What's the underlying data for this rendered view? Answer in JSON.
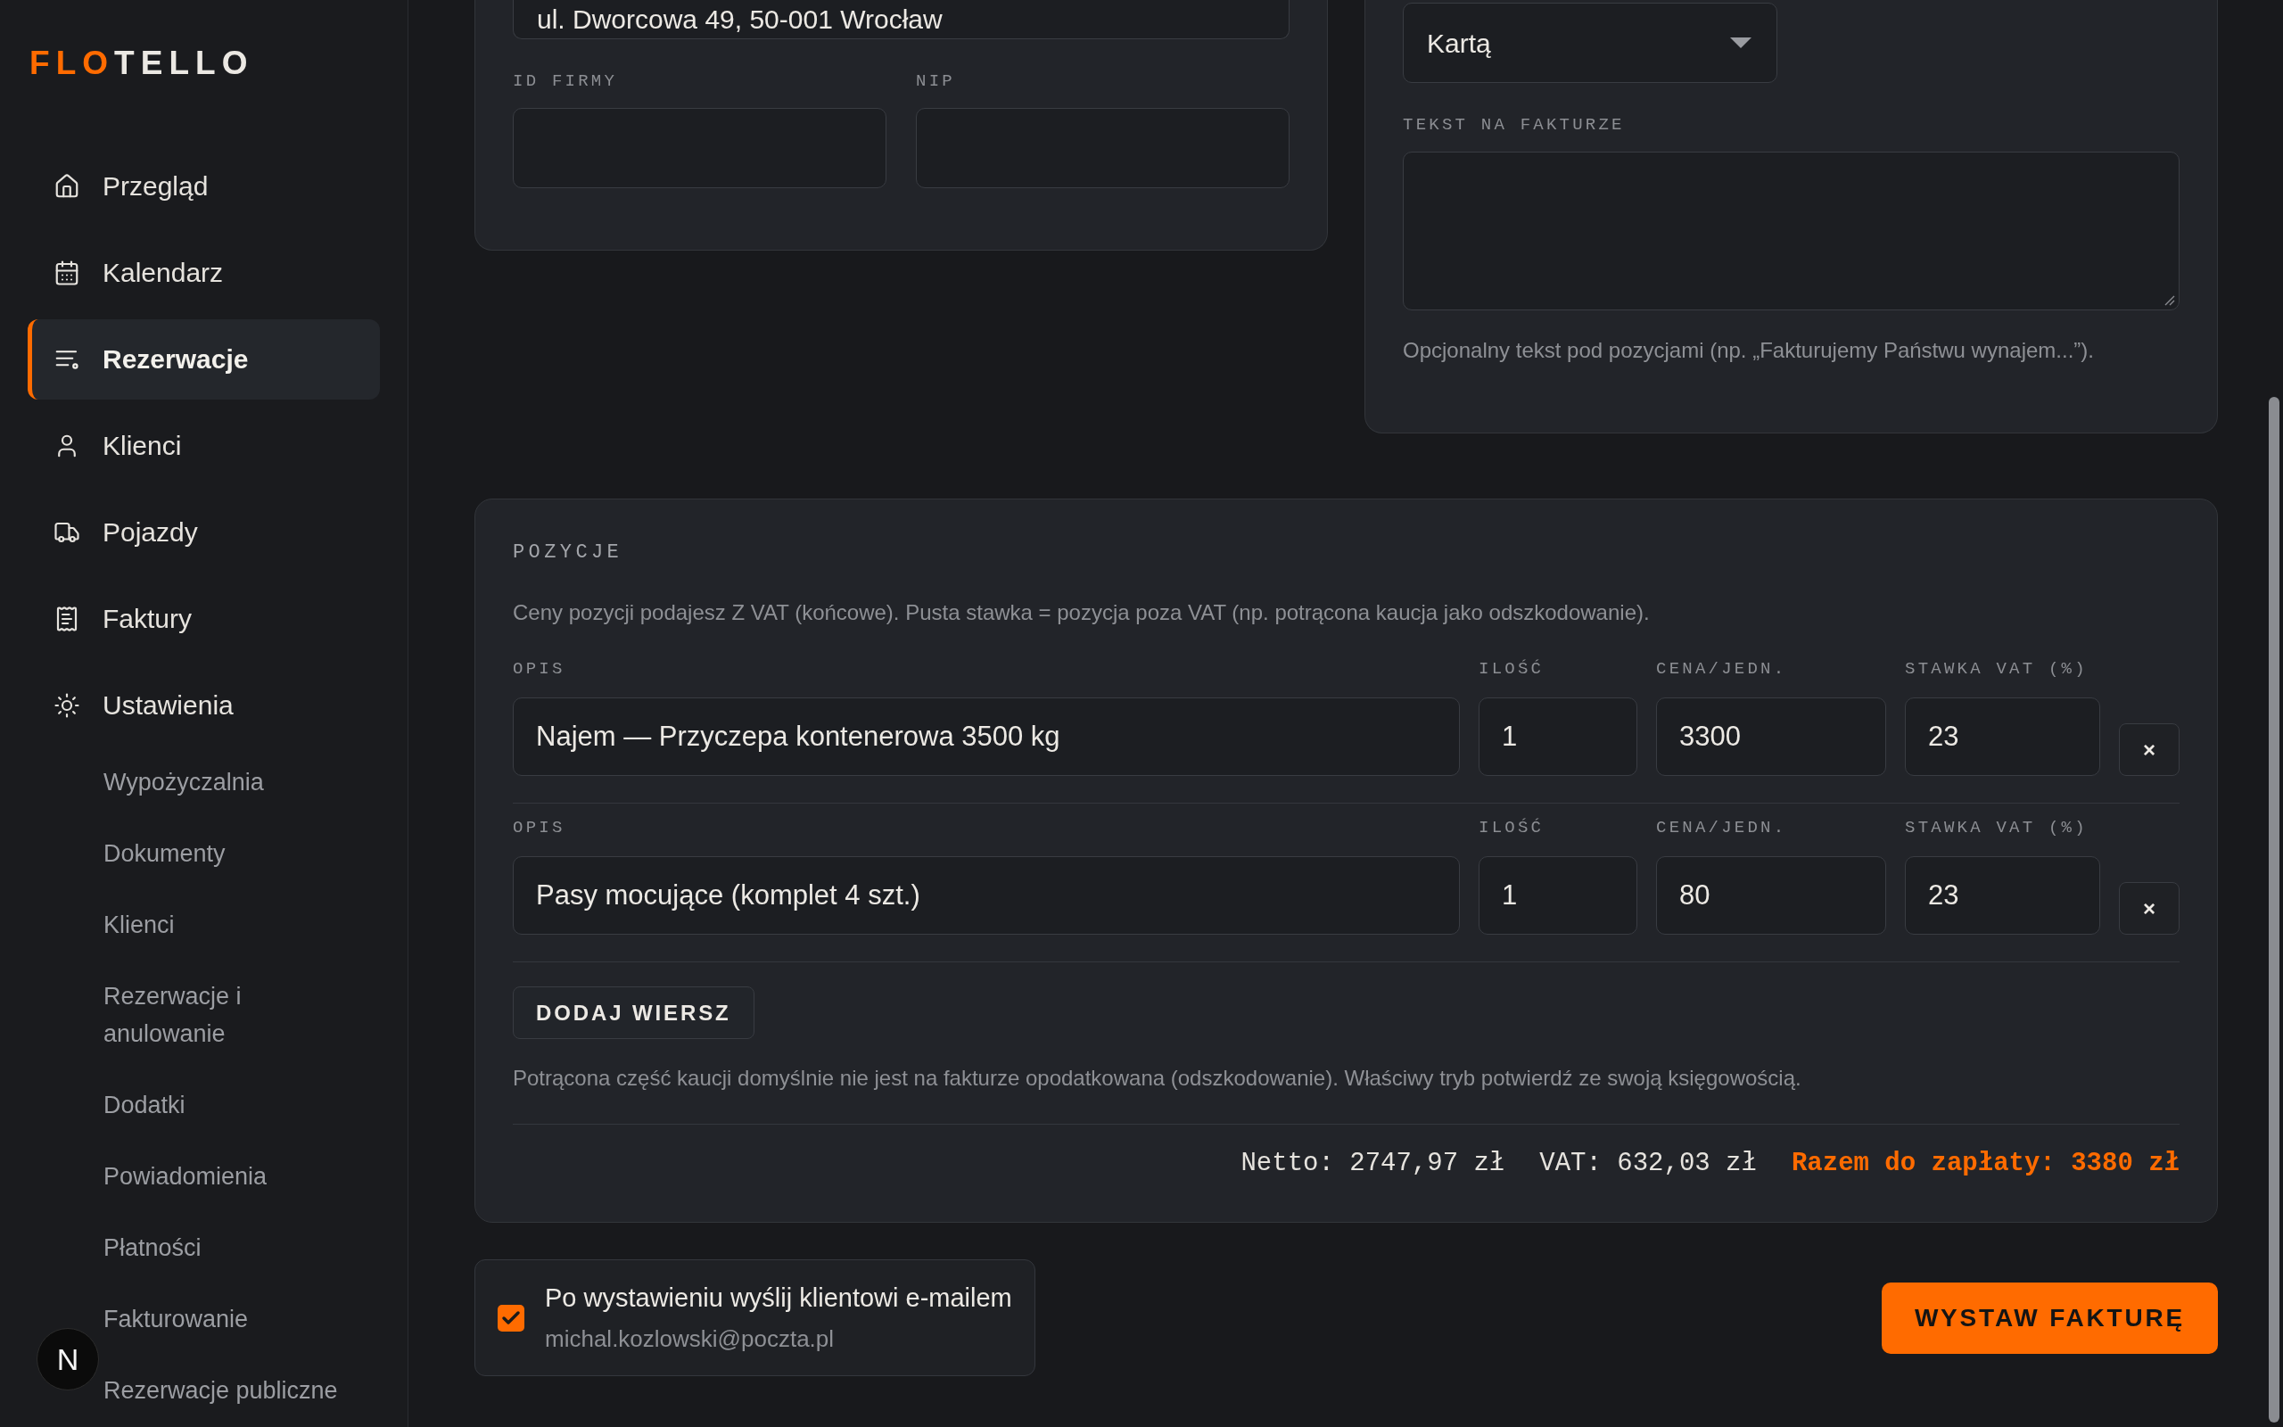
{
  "sidebar": {
    "logo": {
      "highlight": "FLO",
      "rest": "TELLO"
    },
    "nav": [
      {
        "label": "Przegląd",
        "selected": false
      },
      {
        "label": "Kalendarz",
        "selected": false
      },
      {
        "label": "Rezerwacje",
        "selected": true
      },
      {
        "label": "Klienci",
        "selected": false
      },
      {
        "label": "Pojazdy",
        "selected": false
      },
      {
        "label": "Faktury",
        "selected": false
      },
      {
        "label": "Ustawienia",
        "selected": false,
        "children": [
          {
            "label": "Wypożyczalnia",
            "selected": false
          },
          {
            "label": "Dokumenty",
            "selected": false
          },
          {
            "label": "Klienci",
            "selected": false
          },
          {
            "label": "Rezerwacje i anulowanie",
            "selected": false
          },
          {
            "label": "Dodatki",
            "selected": false
          },
          {
            "label": "Powiadomienia",
            "selected": false
          },
          {
            "label": "Płatności",
            "selected": false
          },
          {
            "label": "Fakturowanie",
            "selected": false
          },
          {
            "label": "Rezerwacje publiczne",
            "selected": false
          }
        ]
      }
    ]
  },
  "dev_indicator": {
    "label": "N"
  },
  "company_card": {
    "address": {
      "value": "ul. Dworcowa 49, 50-001 Wrocław"
    },
    "fields": [
      {
        "label": "ID FIRMY"
      },
      {
        "label": "NIP"
      }
    ]
  },
  "invoice_card": {
    "payment_method": {
      "value": "Kartą"
    },
    "invoice_text": {
      "label": "TEKST NA FAKTURZE",
      "hint": "Opcjonalny tekst pod pozycjami (np. „Fakturujemy Państwu wynajem...”)."
    }
  },
  "items": {
    "title": "POZYCJE",
    "description": "Ceny pozycji podajesz Z VAT (końcowe). Pusta stawka = pozycja poza VAT (np. potrącona kaucja jako odszkodowanie).",
    "rows": [
      {
        "fields": [
          {
            "label": "OPIS",
            "value": "Najem — Przyczepa kontenerowa 3500 kg"
          },
          {
            "label": "ILOŚĆ",
            "value": "1"
          },
          {
            "label": "CENA/JEDN.",
            "value": "3300"
          },
          {
            "label": "STAWKA VAT (%)",
            "value": "23"
          }
        ],
        "remove": "×"
      },
      {
        "fields": [
          {
            "label": "OPIS",
            "value": "Pasy mocujące (komplet 4 szt.)"
          },
          {
            "label": "ILOŚĆ",
            "value": "1"
          },
          {
            "label": "CENA/JEDN.",
            "value": "80"
          },
          {
            "label": "STAWKA VAT (%)",
            "value": "23"
          }
        ],
        "remove": "×"
      }
    ],
    "add_row": "DODAJ WIERSZ",
    "note": "Potrącona część kaucji domyślnie nie jest na fakturze opodatkowana (odszkodowanie). Właściwy tryb potwierdź ze swoją księgowością.",
    "totals": {
      "net": "Netto: 2747,97 zł",
      "vat": "VAT: 632,03 zł",
      "total": "Razem do zapłaty: 3380 zł"
    }
  },
  "send_email": {
    "checked": true,
    "label": "Po wystawieniu wyślij klientowi e-mailem",
    "email": "michal.kozlowski@poczta.pl"
  },
  "submit": {
    "label": "WYSTAW FAKTURĘ"
  }
}
